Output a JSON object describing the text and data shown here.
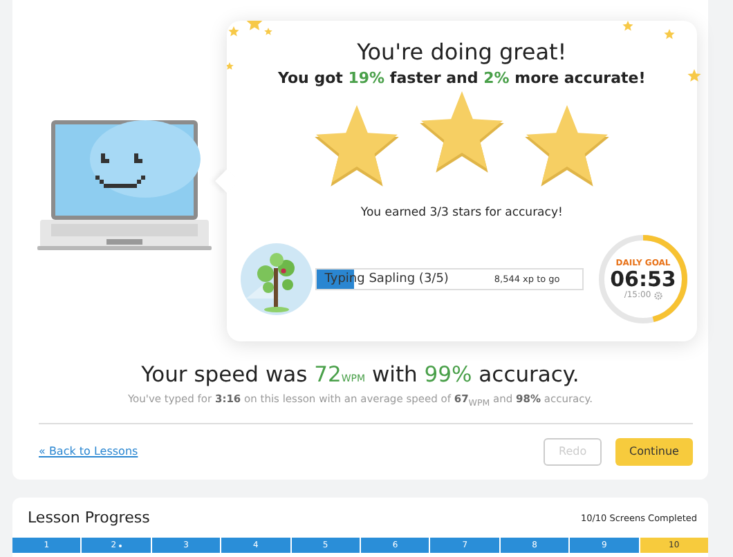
{
  "result": {
    "title": "You're doing great!",
    "subtitle": "You got **19%** faster and **2%** more accurate!",
    "stars": 3,
    "stars_note": "You earned 3/3 stars for accuracy!"
  },
  "rank": {
    "label": "Typing Sapling (3/5)",
    "level": 0.14,
    "xp_to_go": "8,544 xp to go"
  },
  "daily_goal": {
    "label": "DAILY GOAL",
    "time": "06:53",
    "target": "/15:00",
    "level": 0.46
  },
  "speed": {
    "parts": [
      "Your speed was ",
      "72",
      "WPM",
      " with ",
      "99%",
      " accuracy."
    ],
    "detail": "You've typed for **3:16** on this lesson with an average speed of **67**$_{WPM}$ and **98%** accuracy."
  },
  "back_link": "« Back to Lessons",
  "buttons": [
    {
      "label": "Redo",
      "disabled": true
    },
    {
      "label": "Continue",
      "disabled": false
    }
  ],
  "lesson_progress": {
    "title": "Lesson Progress",
    "summary": "10/10 Screens Completed",
    "screens": [
      {
        "label": "1",
        "selected": false,
        "dot": false
      },
      {
        "label": "2",
        "selected": false,
        "dot": true
      },
      {
        "label": "3",
        "selected": false,
        "dot": false
      },
      {
        "label": "4",
        "selected": false,
        "dot": false
      },
      {
        "label": "5",
        "selected": false,
        "dot": false
      },
      {
        "label": "6",
        "selected": false,
        "dot": false
      },
      {
        "label": "7",
        "selected": false,
        "dot": false
      },
      {
        "label": "8",
        "selected": false,
        "dot": false
      },
      {
        "label": "9",
        "selected": false,
        "dot": false
      },
      {
        "label": "10",
        "selected": true,
        "dot": false
      }
    ]
  }
}
